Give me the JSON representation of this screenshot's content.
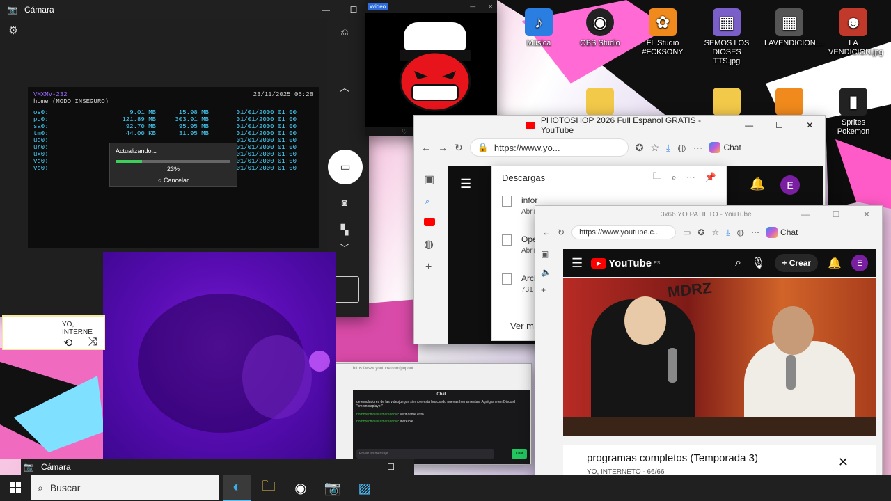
{
  "desktop": {
    "icons": [
      {
        "label": "Música",
        "glyph": "♪",
        "color": "#2a7de1"
      },
      {
        "label": "OBS Studio",
        "glyph": "◉",
        "color": "#222222"
      },
      {
        "label": "FL Studio #FCKSONY",
        "glyph": "✿",
        "color": "#f08a1c"
      },
      {
        "label": "SEMOS LOS DIOSES TTS.jpg",
        "glyph": "▦",
        "color": "#7b5fc9"
      },
      {
        "label": "LAVENDICION....",
        "glyph": "▦",
        "color": "#555555"
      },
      {
        "label": "LA VENDICION.jpg",
        "glyph": "☻",
        "color": "#c0392b"
      },
      {
        "label": "Sprites Pokemon",
        "glyph": "▮",
        "color": "#222222"
      }
    ]
  },
  "camera": {
    "title": "Cámara",
    "psp": {
      "header_left": "VMXMV-232",
      "header_sub": "home (MODO INSEGURO)",
      "datetime": "23/11/2025  06:28",
      "rows": [
        {
          "name": "os0:",
          "used": "9.01 MB",
          "total": "15.98 MB",
          "date": "01/01/2000 01:00"
        },
        {
          "name": "pd0:",
          "used": "121.89 MB",
          "total": "303.91 MB",
          "date": "01/01/2000 01:00"
        },
        {
          "name": "sa0:",
          "used": "92.70 MB",
          "total": "95.95 MB",
          "date": "01/01/2000 01:00"
        },
        {
          "name": "tm0:",
          "used": "44.00 KB",
          "total": "31.95 MB",
          "date": "01/01/2000 01:00"
        },
        {
          "name": "ud0:",
          "used": "",
          "total": "",
          "date": "01/01/2000 01:00"
        },
        {
          "name": "ur0:",
          "used": "",
          "total": "",
          "date": "01/01/2000 01:00"
        },
        {
          "name": "ux0:",
          "used": "",
          "total": "",
          "date": "01/01/2000 01:00"
        },
        {
          "name": "vd0:",
          "used": "",
          "total": "",
          "date": "01/01/2000 01:00"
        },
        {
          "name": "vs0:",
          "used": "",
          "total": "",
          "date": "01/01/2000 01:00"
        }
      ],
      "dialog_title": "Actualizando...",
      "progress_label": "23%",
      "progress": 0.23,
      "cancel_label": "○ Cancelar"
    }
  },
  "mini_viewer": {
    "title": "xvideo"
  },
  "music_bar": {
    "text": "YO, INTERNE"
  },
  "browser1": {
    "title": "PHOTOSHOP 2026 Full Espanol GRATIS - YouTube",
    "url": "https://www.yo...",
    "chat_label": "Chat",
    "downloads": {
      "title": "Descargas",
      "items": [
        {
          "name": "infor",
          "action": "Abrir"
        },
        {
          "name": "Ope",
          "action": "Abrir"
        },
        {
          "name": "Arch",
          "action": "731 K"
        }
      ],
      "more": "Ver m"
    }
  },
  "browser2": {
    "title": "3x66 YO PATIETO - YouTube",
    "url": "https://www.youtube.c...",
    "chat_label": "Chat",
    "youtube": {
      "logo": "YouTube",
      "region": "ES",
      "create": "Crear",
      "avatar": "E",
      "video_text": "MDRZ",
      "playlist_title": "programas completos (Temporada 3)",
      "playlist_meta": "YO, INTERNETO - 66/66"
    }
  },
  "chatwin": {
    "title": "Chat",
    "url": "https://www.youtube.com/popout",
    "message": "de emuladores de las videojuegos siempre está buscando nuevas herramientas. Agrégame en Discord \"xmemoraplayer\"",
    "lines": [
      {
        "user": "nombreofficialcamaradoble",
        "text": "verifícame esto"
      },
      {
        "user": "nombreofficialcamaradoble",
        "text": "increíble"
      }
    ],
    "input_placeholder": "Enviar un mensaje",
    "send": "Chat"
  },
  "taskbar": {
    "search_placeholder": "Buscar",
    "cam_title": "Cámara"
  },
  "colors": {
    "accent": "#4cc2ff",
    "yt_red": "#ff0000",
    "purple": "#6a14c5"
  }
}
